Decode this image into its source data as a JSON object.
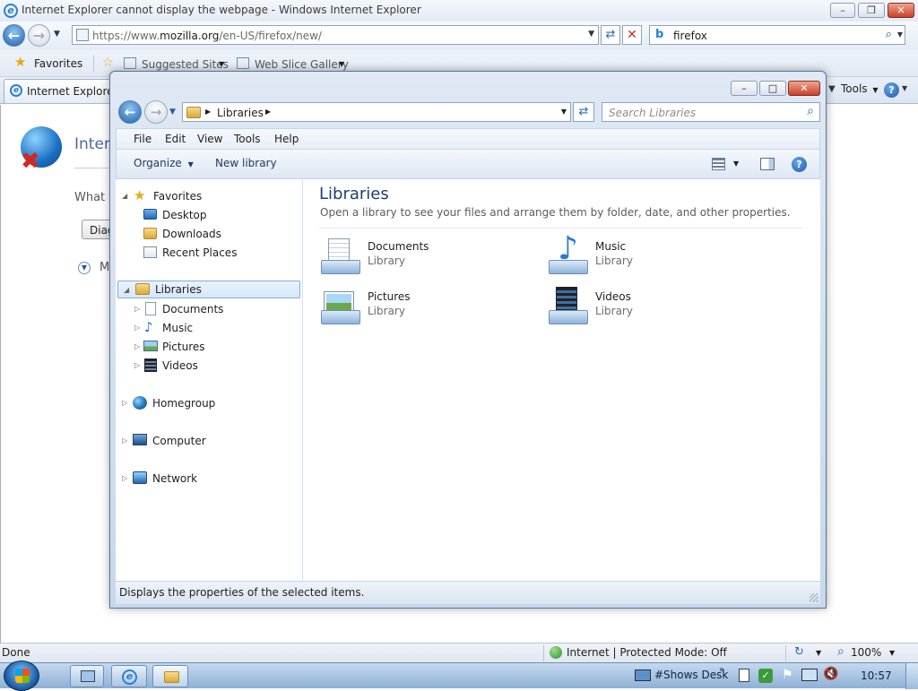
{
  "ie": {
    "title": "Internet Explorer cannot display the webpage - Windows Internet Explorer",
    "url_prefix": "https://www.",
    "url_host": "mozilla.org",
    "url_path": "/en-US/firefox/new/",
    "search_value": "firefox",
    "favorites_label": "Favorites",
    "suggested_sites": "Suggested Sites",
    "web_slice_gallery": "Web Slice Gallery",
    "tab_label": "Internet Explorer c",
    "tools_label": "Tools",
    "content": {
      "heading_partial": "Intern",
      "what_partial": "What y",
      "diag_partial": "Diag",
      "more_partial": "M"
    },
    "status": {
      "left": "Done",
      "zone": "Internet | Protected Mode: Off",
      "zoom": "100%"
    }
  },
  "explorer": {
    "breadcrumb": "Libraries",
    "search_placeholder": "Search Libraries",
    "menu": [
      "File",
      "Edit",
      "View",
      "Tools",
      "Help"
    ],
    "commands": {
      "organize": "Organize",
      "new_library": "New library"
    },
    "nav": {
      "favorites": "Favorites",
      "desktop": "Desktop",
      "downloads": "Downloads",
      "recent": "Recent Places",
      "libraries": "Libraries",
      "documents": "Documents",
      "music": "Music",
      "pictures": "Pictures",
      "videos": "Videos",
      "homegroup": "Homegroup",
      "computer": "Computer",
      "network": "Network"
    },
    "main": {
      "title": "Libraries",
      "subtitle": "Open a library to see your files and arrange them by folder, date, and other properties.",
      "libraries": [
        {
          "name": "Documents",
          "type": "Library"
        },
        {
          "name": "Music",
          "type": "Library"
        },
        {
          "name": "Pictures",
          "type": "Library"
        },
        {
          "name": "Videos",
          "type": "Library"
        }
      ]
    },
    "status_text": "Displays the properties of the selected items."
  },
  "taskbar": {
    "toolbar_label": "#Shows Desk",
    "clock": "10:57"
  }
}
